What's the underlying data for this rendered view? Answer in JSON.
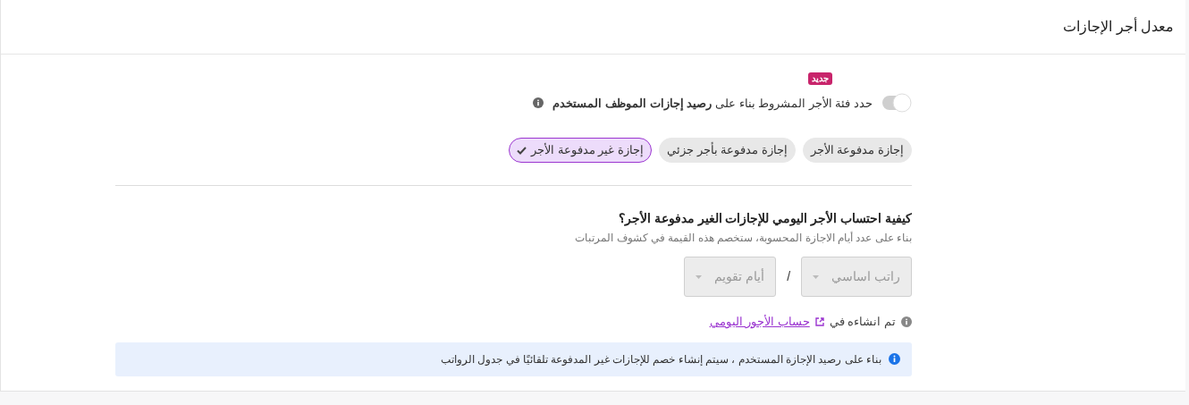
{
  "header": {
    "title": "معدل أجر الإجازات"
  },
  "toggle": {
    "label": "حدد فئة الأجر المشروط بناء على **رصيد إجازات الموظف المستخدم**",
    "on": false,
    "badge": "جديد"
  },
  "chips": [
    {
      "label": "إجازة مدفوعة الأجر",
      "selected": false
    },
    {
      "label": "إجازة مدفوعة بأجر جزئي",
      "selected": false
    },
    {
      "label": "إجازة غير مدفوعة الأجر",
      "selected": true
    }
  ],
  "question": {
    "title": "كيفية احتساب الأجر اليومي للإجازات الغير مدفوعة الأجر؟",
    "hint": "بناء على عدد أيام الاجازة المحسوبة، ستخصم هذه القيمة في كشوف المرتبات"
  },
  "selects": [
    {
      "value": "راتب اساسي",
      "disabled": true
    },
    {
      "value": "أيام تقويم",
      "disabled": true
    }
  ],
  "separator": "/",
  "created": {
    "prefix": "تم انشاءه في",
    "link": "حساب الأجور اليومي"
  },
  "notice": "بناء على رصيد الإجازة المستخدم ، سيتم إنشاء خصم للإجازات غير المدفوعة تلقائيًا في جدول الرواتب"
}
